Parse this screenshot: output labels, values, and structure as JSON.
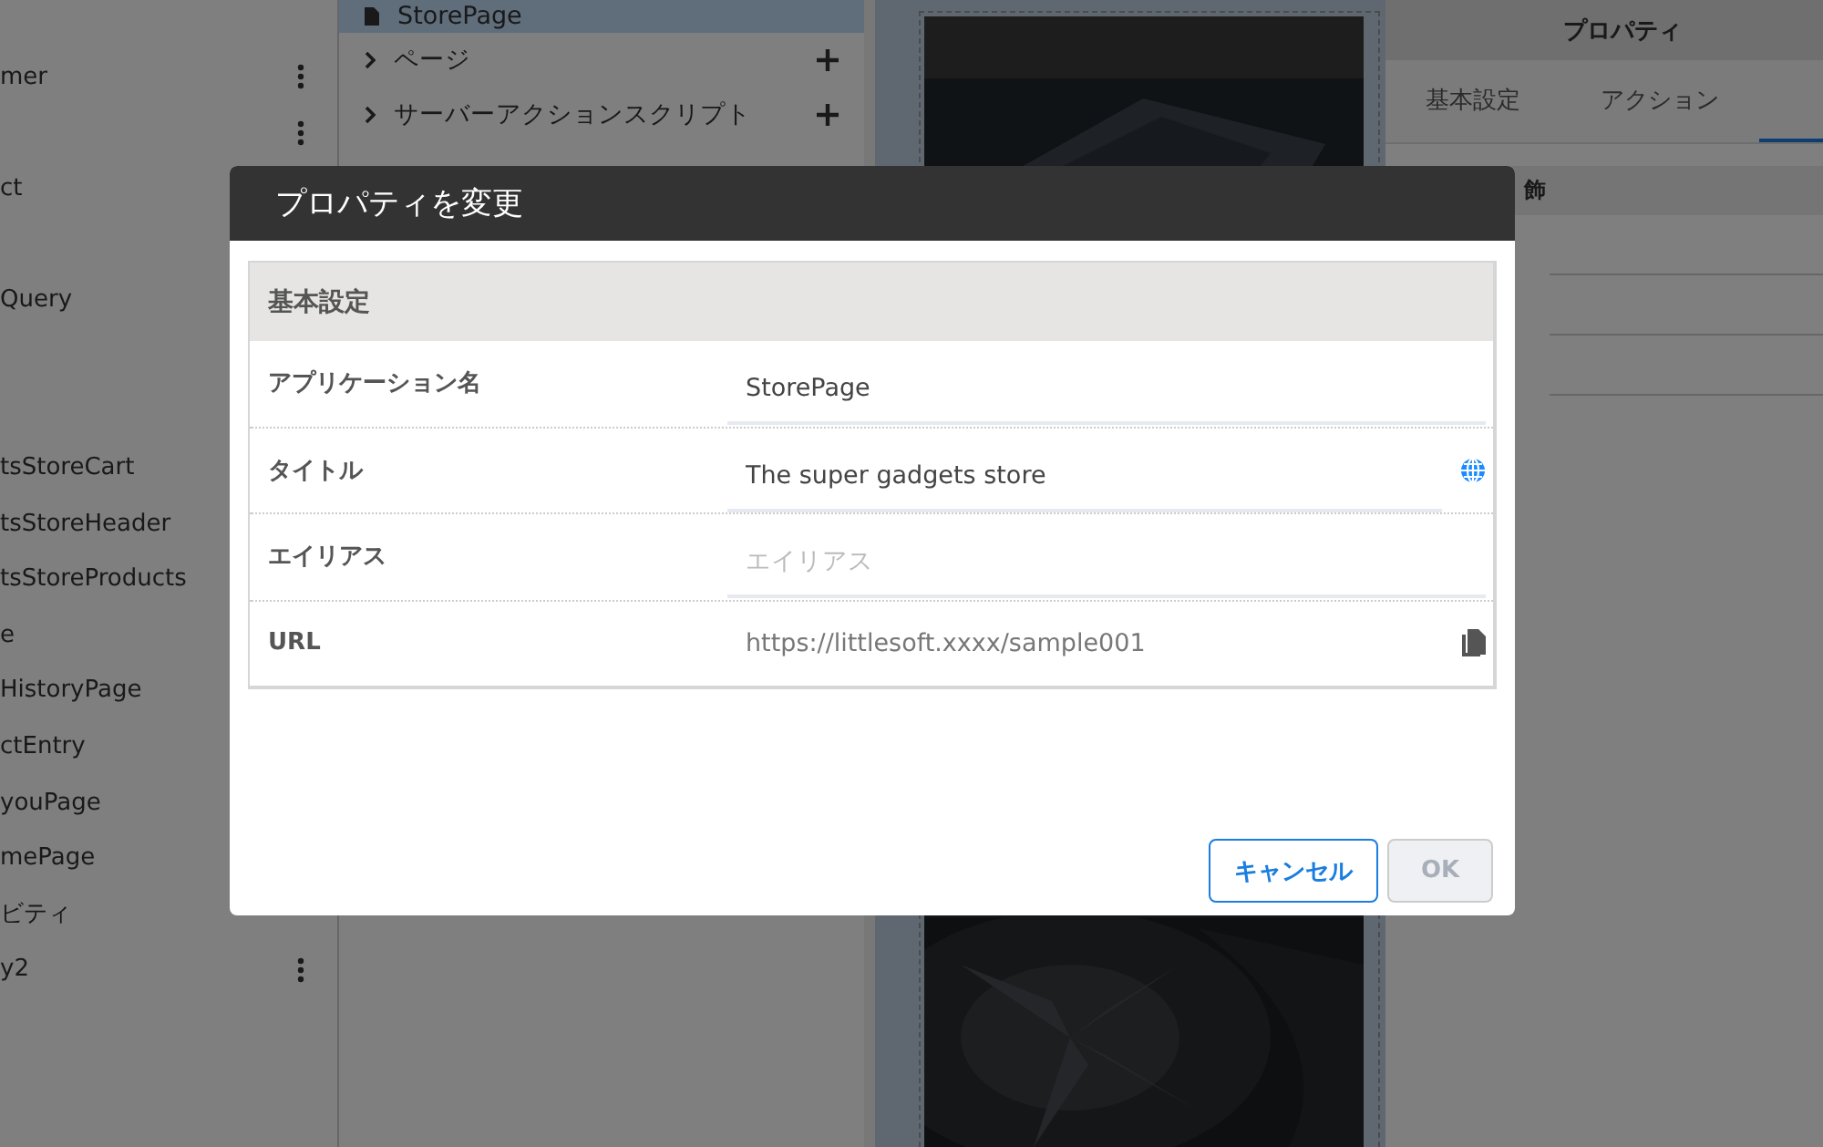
{
  "left_panel": {
    "items": [
      {
        "kind": "entry",
        "label": "mer",
        "menu": true
      },
      {
        "kind": "entry",
        "menu": true
      },
      {
        "kind": "entry",
        "label": "ct"
      },
      {
        "kind": "blank"
      },
      {
        "kind": "entry",
        "label": "Query"
      },
      {
        "kind": "blank"
      },
      {
        "kind": "blank"
      },
      {
        "kind": "entry",
        "label": "tsStoreCart"
      },
      {
        "kind": "entry",
        "label": "tsStoreHeader"
      },
      {
        "kind": "entry",
        "label": "tsStoreProducts"
      },
      {
        "kind": "entry",
        "label": "e"
      },
      {
        "kind": "entry",
        "label": "HistoryPage"
      },
      {
        "kind": "entry",
        "label": "ctEntry"
      },
      {
        "kind": "entry",
        "label": "youPage"
      },
      {
        "kind": "entry",
        "label": "mePage"
      },
      {
        "kind": "entry",
        "label": "ビティ"
      },
      {
        "kind": "entry",
        "label": "y2",
        "menu": true
      }
    ]
  },
  "tree": {
    "items": [
      {
        "label": "StorePage",
        "kind": "page",
        "selected": true
      },
      {
        "label": "ページ",
        "kind": "folder",
        "selected": false
      },
      {
        "label": "サーバーアクションスクリプト",
        "kind": "folder",
        "selected": false
      }
    ]
  },
  "properties": {
    "title": "プロパティ",
    "tabs": [
      {
        "label": "基本設定",
        "selected": false
      },
      {
        "label": "アクション",
        "selected": false
      },
      {
        "selected": true
      }
    ],
    "section": "飾"
  },
  "dialog": {
    "title": "プロパティを変更",
    "section": "基本設定",
    "fields": [
      {
        "label": "アプリケーション名",
        "value": "StorePage",
        "kind": "text"
      },
      {
        "label": "タイトル",
        "value": "The super gadgets store",
        "kind": "translatable"
      },
      {
        "label": "エイリアス",
        "placeholder": "エイリアス",
        "kind": "text"
      },
      {
        "label": "URL",
        "value": "https://littlesoft.xxxx/sample001",
        "kind": "link"
      }
    ],
    "buttons": [
      {
        "label": "キャンセル",
        "disabled": false
      },
      {
        "label": "OK",
        "disabled": true
      }
    ]
  }
}
